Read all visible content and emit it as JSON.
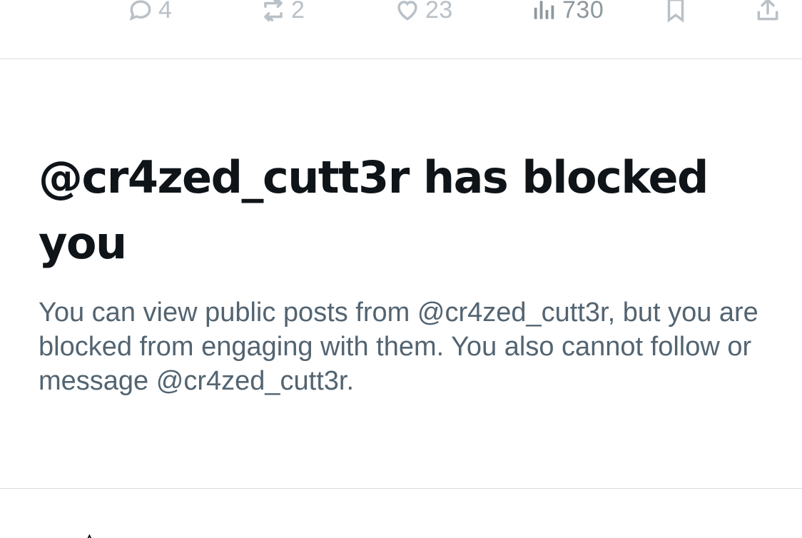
{
  "actions": {
    "reply": {
      "icon": "comment-icon",
      "count": "4"
    },
    "repost": {
      "icon": "repost-icon",
      "count": "2"
    },
    "like": {
      "icon": "heart-icon",
      "count": "23"
    },
    "views": {
      "icon": "views-chart-icon",
      "count": "730"
    },
    "bookmark": {
      "icon": "bookmark-icon"
    },
    "share": {
      "icon": "share-icon"
    }
  },
  "blocked_notice": {
    "title": "@cr4zed_cutt3r has blocked you",
    "description": "You can view public posts from @cr4zed_cutt3r, but you are blocked from engaging with them. You also cannot follow or message @cr4zed_cutt3r."
  },
  "colors": {
    "title": "#0f1419",
    "secondary_text": "#536471",
    "action_icons": "#b9c0c7",
    "divider": "#d9dde1"
  }
}
